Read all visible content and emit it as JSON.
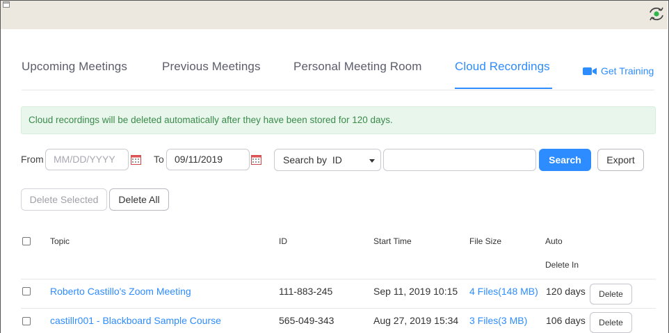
{
  "tabs": {
    "upcoming": "Upcoming Meetings",
    "previous": "Previous Meetings",
    "pmr": "Personal Meeting Room",
    "cloud": "Cloud Recordings",
    "get_training": "Get Training"
  },
  "notice": "Cloud recordings will be deleted automatically after they have been stored for 120 days.",
  "filters": {
    "from_label": "From",
    "from_placeholder": "MM/DD/YYYY",
    "to_label": "To",
    "to_value": "09/11/2019",
    "search_by": "Search by  ID",
    "search_button": "Search",
    "export_button": "Export"
  },
  "bulk": {
    "delete_selected": "Delete Selected",
    "delete_all": "Delete All"
  },
  "table": {
    "headers": {
      "topic": "Topic",
      "id": "ID",
      "start_time": "Start Time",
      "file_size": "File Size",
      "auto_line1": "Auto",
      "auto_line2": "Delete In"
    },
    "rows": [
      {
        "topic": "Roberto Castillo's Zoom Meeting",
        "id": "111-883-245",
        "start_time": "Sep 11, 2019 10:15",
        "file_size": "4 Files(148 MB)",
        "auto_delete": "120 days",
        "action": "Delete"
      },
      {
        "topic": "castillr001 - Blackboard Sample Course",
        "id": "565-049-343",
        "start_time": "Aug 27, 2019 15:34",
        "file_size": "3 Files(3 MB)",
        "auto_delete": "106 days",
        "action": "Delete"
      }
    ]
  },
  "colors": {
    "accent": "#2d8cff",
    "notice_bg": "#e8f6ec",
    "notice_text": "#3a8a4a",
    "topbar": "#ece8e0"
  },
  "icons": [
    "window-corner-icon",
    "sync-eye-icon",
    "video-camera-icon",
    "calendar-icon",
    "chevron-down-icon"
  ]
}
